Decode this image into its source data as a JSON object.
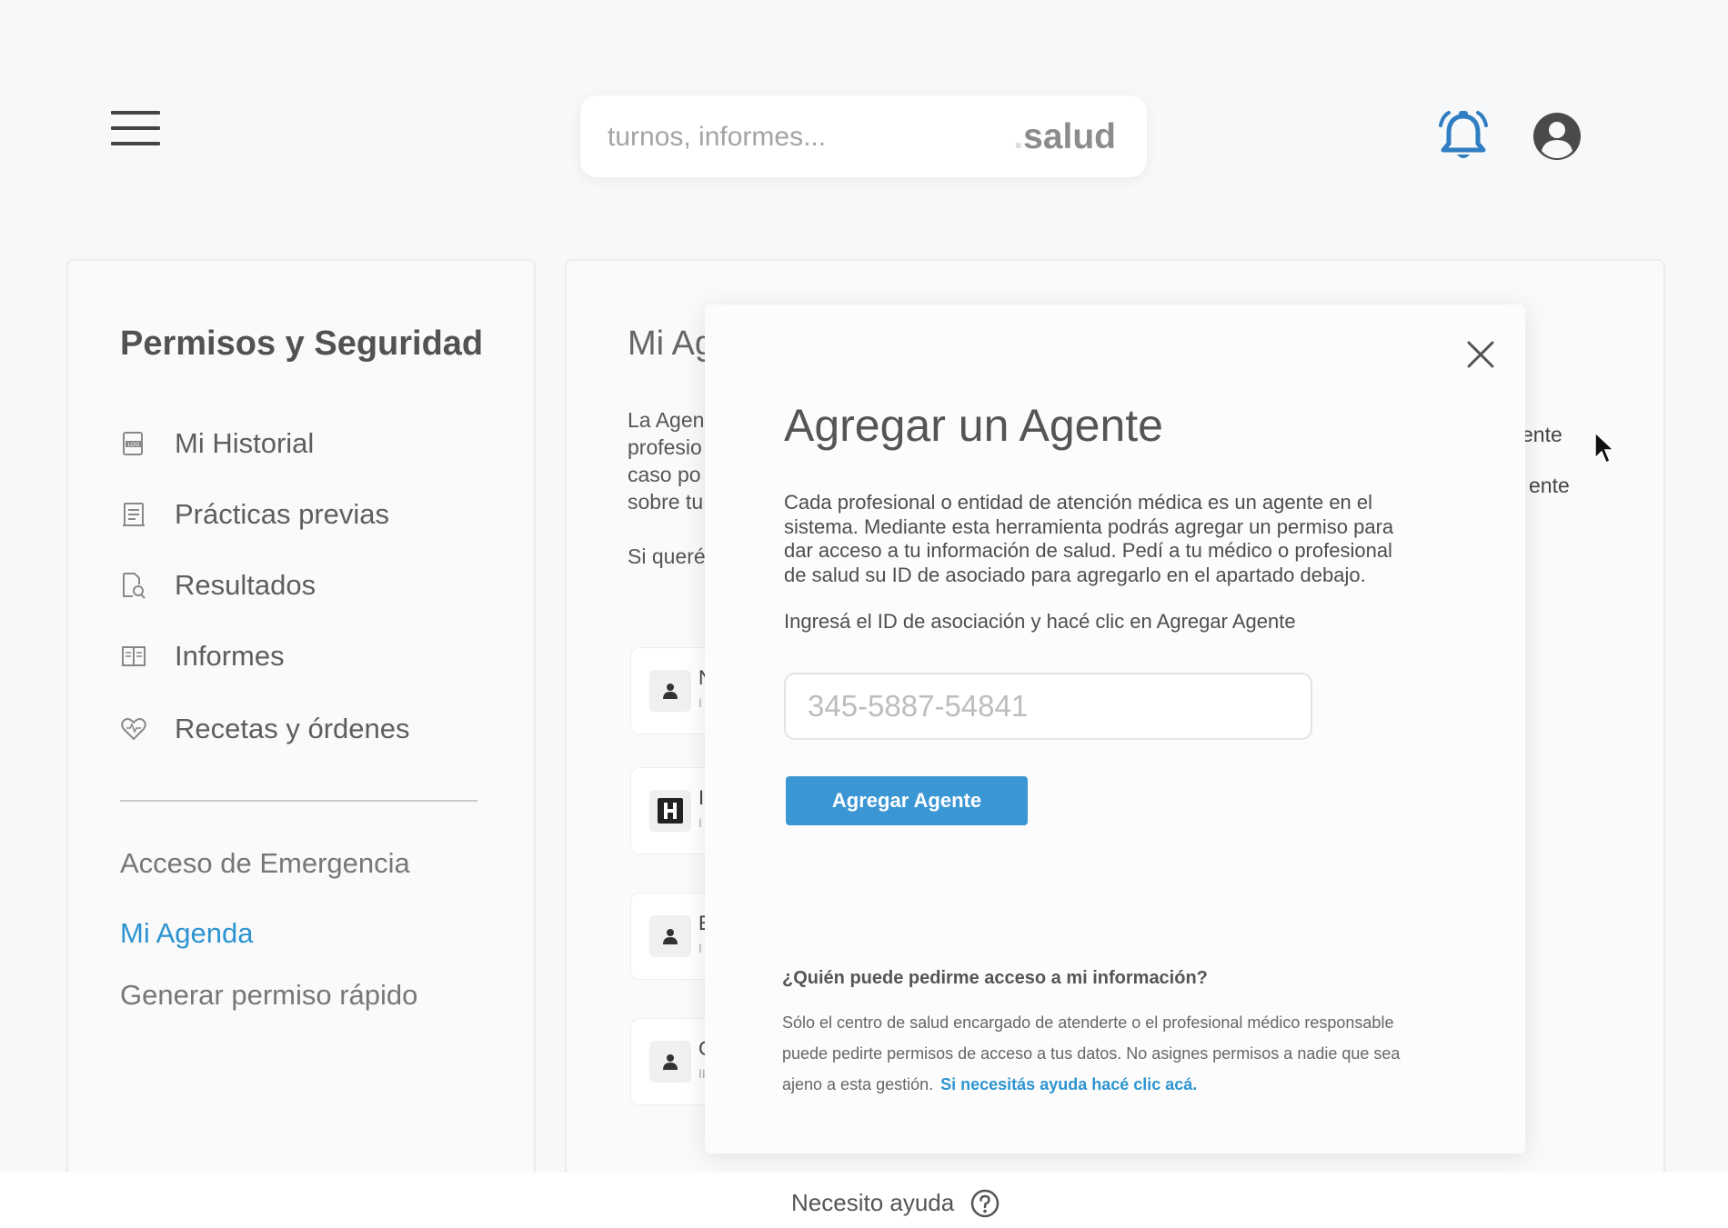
{
  "header": {
    "search_placeholder": "turnos, informes...",
    "brand_dot": ".",
    "brand_name": "salud"
  },
  "sidebar": {
    "title": "Permisos y Seguridad",
    "items": [
      {
        "label": "Mi Historial",
        "icon": "log-file-icon"
      },
      {
        "label": "Prácticas previas",
        "icon": "clipboard-list-icon"
      },
      {
        "label": "Resultados",
        "icon": "document-search-icon"
      },
      {
        "label": "Informes",
        "icon": "book-icon"
      },
      {
        "label": "Recetas y órdenes",
        "icon": "heart-pulse-icon"
      }
    ],
    "links": [
      {
        "label": "Acceso de Emergencia"
      },
      {
        "label": "Mi Agenda"
      },
      {
        "label": "Generar permiso rápido"
      }
    ]
  },
  "main": {
    "title": "Mi Agenda",
    "desc_lines": [
      "La Agen",
      "profesio",
      "caso po",
      "sobre tu"
    ],
    "desc2": "Si querés",
    "right_text_1": "ente",
    "right_text_2": "ente",
    "agents": [
      {
        "initial": "N",
        "sub": "I",
        "icon": "person-icon"
      },
      {
        "initial": "I",
        "sub": "I",
        "icon": "hospital-icon"
      },
      {
        "initial": "E",
        "sub": "I",
        "icon": "person-icon"
      },
      {
        "initial": "C",
        "sub": "II",
        "icon": "person-icon"
      }
    ]
  },
  "modal": {
    "title": "Agregar un Agente",
    "description": "Cada profesional o entidad de atención médica es un agente en el sistema. Mediante esta herramienta podrás agregar un permiso para dar acceso a tu información de salud. Pedí a tu médico o profesional de salud su ID de asociado para agregarlo en el apartado debajo.",
    "instruction": "Ingresá el ID de asociación y hacé clic en Agregar Agente",
    "input_placeholder": "345-5887-54841",
    "button_label": "Agregar Agente",
    "faq_question": "¿Quién puede pedirme acceso a mi información?",
    "faq_answer": "Sólo el centro de salud encargado de atenderte o el profesional médico responsable puede pedirte permisos de acceso a tus datos. No asignes permisos a nadie que sea ajeno a esta gestión.",
    "faq_link": "Si necesitás ayuda hacé clic acá."
  },
  "footer": {
    "help_label": "Necesito ayuda"
  },
  "colors": {
    "accent": "#2d94d0",
    "button": "#3b97d3",
    "bell": "#2f7dc2"
  }
}
